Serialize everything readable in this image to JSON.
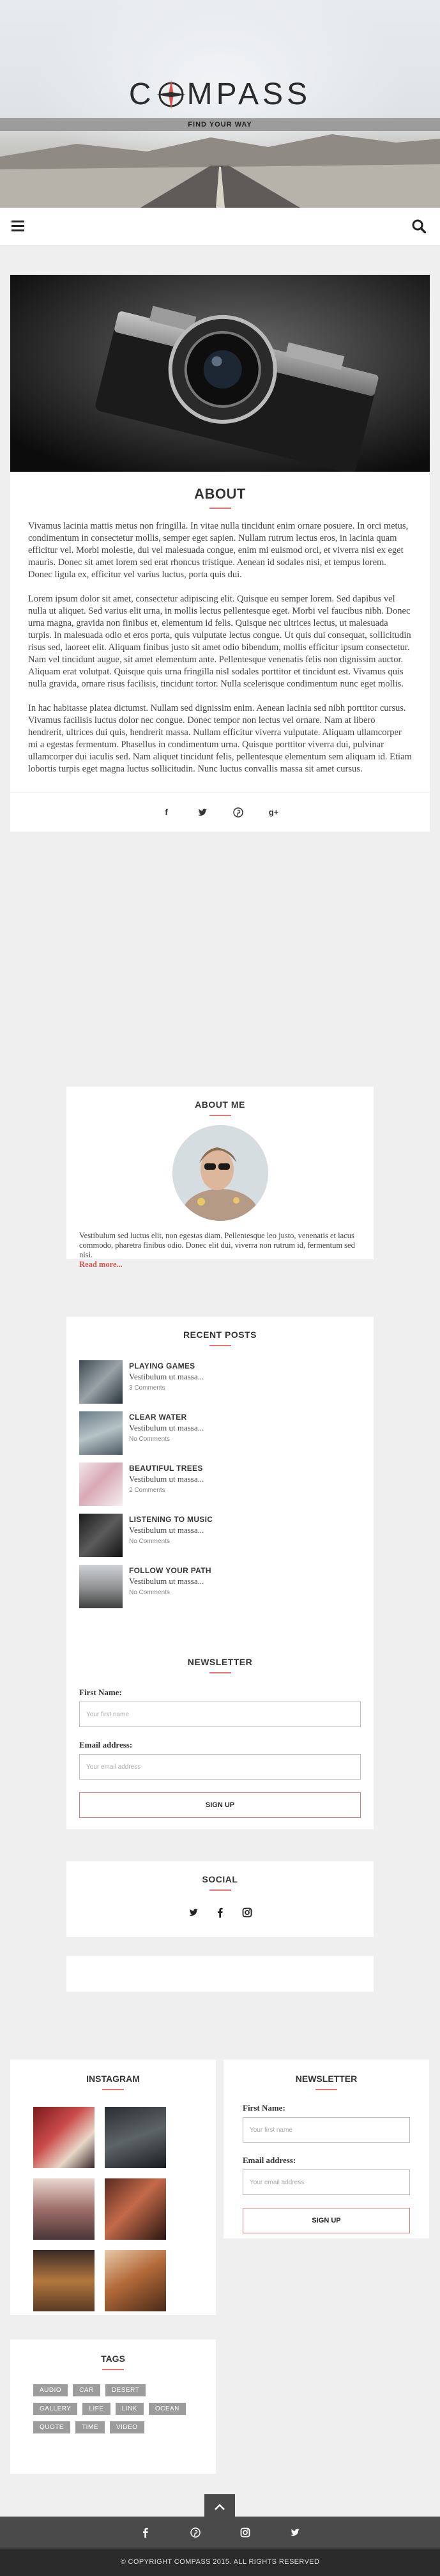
{
  "header": {
    "logo_text_left": "C",
    "logo_text_right": "MPASS",
    "tagline": "FIND YOUR WAY"
  },
  "article": {
    "title": "ABOUT",
    "paragraphs": [
      "Vivamus lacinia mattis metus non fringilla. In vitae nulla tincidunt enim ornare posuere. In orci metus, condimentum in consectetur mollis, semper eget sapien. Nullam rutrum lectus eros, in lacinia quam efficitur vel. Morbi molestie, dui vel malesuada congue, enim mi euismod orci, et viverra nisi ex eget mauris. Donec sit amet lorem sed erat rhoncus tristique. Aenean id sodales nisi, et tempus lorem. Donec ligula ex, efficitur vel varius luctus, porta quis dui.",
      "Lorem ipsum dolor sit amet, consectetur adipiscing elit. Quisque eu semper lorem. Sed dapibus vel nulla ut aliquet. Sed varius elit urna, in mollis lectus pellentesque eget. Morbi vel faucibus nibh. Donec urna magna, gravida non finibus et, elementum id felis. Quisque nec ultrices lectus, ut malesuada turpis. In malesuada odio et eros porta, quis vulputate lectus congue. Ut quis dui consequat, sollicitudin risus sed, laoreet elit. Aliquam finibus justo sit amet odio bibendum, mollis efficitur ipsum consectetur. Nam vel tincidunt augue, sit amet elementum ante. Pellentesque venenatis felis non dignissim auctor. Aliquam erat volutpat. Quisque quis urna fringilla nisl sodales porttitor et tincidunt est. Vivamus quis nulla gravida, ornare risus facilisis, tincidunt tortor. Nulla scelerisque condimentum nunc eget mollis.",
      "In hac habitasse platea dictumst. Nullam sed dignissim enim. Aenean lacinia sed nibh porttitor cursus. Vivamus facilisis luctus dolor nec congue. Donec tempor non lectus vel ornare. Nam at libero hendrerit, ultrices dui quis, hendrerit massa. Nullam efficitur viverra vulputate. Aliquam ullamcorper mi a egestas fermentum. Phasellus in condimentum urna. Quisque porttitor viverra dui, pulvinar ullamcorper dui iaculis sed. Nam aliquet tincidunt felis, pellentesque elementum sem aliquam id. Etiam lobortis turpis eget magna luctus sollicitudin. Nunc luctus convallis massa sit amet cursus."
    ],
    "share": [
      "f",
      "twitter",
      "pinterest",
      "g+"
    ],
    "share_glyphs": {
      "facebook": "f",
      "googleplus": "g+"
    }
  },
  "about_me": {
    "title": "ABOUT ME",
    "text": "Vestibulum sed luctus elit, non egestas diam. Pellentesque leo justo, venenatis et lacus commodo, pharetra finibus odio. Donec elit dui, viverra non rutrum id, fermentum sed nisi.",
    "read_more": "Read more..."
  },
  "recent_posts": {
    "title": "RECENT POSTS",
    "items": [
      {
        "title": "PLAYING GAMES",
        "excerpt": "Vestibulum ut massa...",
        "comments": "3 Comments"
      },
      {
        "title": "CLEAR WATER",
        "excerpt": "Vestibulum ut massa...",
        "comments": "No Comments"
      },
      {
        "title": "BEAUTIFUL TREES",
        "excerpt": "Vestibulum ut massa...",
        "comments": "2 Comments"
      },
      {
        "title": "LISTENING TO MUSIC",
        "excerpt": "Vestibulum ut massa...",
        "comments": "No Comments"
      },
      {
        "title": "FOLLOW YOUR PATH",
        "excerpt": "Vestibulum ut massa...",
        "comments": "No Comments"
      }
    ]
  },
  "newsletter": {
    "title": "NEWSLETTER",
    "first_name_label": "First Name:",
    "first_name_placeholder": "Your first name",
    "email_label": "Email address:",
    "email_placeholder": "Your email address",
    "signup": "SIGN UP"
  },
  "social": {
    "title": "SOCIAL"
  },
  "instagram": {
    "title": "INSTAGRAM"
  },
  "newsletter2": {
    "title": "NEWSLETTER",
    "first_name_label": "First Name:",
    "first_name_placeholder": "Your first name",
    "email_label": "Email address:",
    "email_placeholder": "Your email address",
    "signup": "SIGN UP"
  },
  "tags": {
    "title": "TAGS",
    "items": [
      "AUDIO",
      "CAR",
      "DESERT",
      "GALLERY",
      "LIFE",
      "LINK",
      "OCEAN",
      "QUOTE",
      "TIME",
      "VIDEO"
    ]
  },
  "footer": {
    "copyright": "© COPYRIGHT COMPASS 2015. ALL RIGHTS RESERVED"
  },
  "colors": {
    "accent": "#e0766e",
    "footer_dark": "#2b2b2b",
    "footer_mid": "#4a4a4a"
  }
}
